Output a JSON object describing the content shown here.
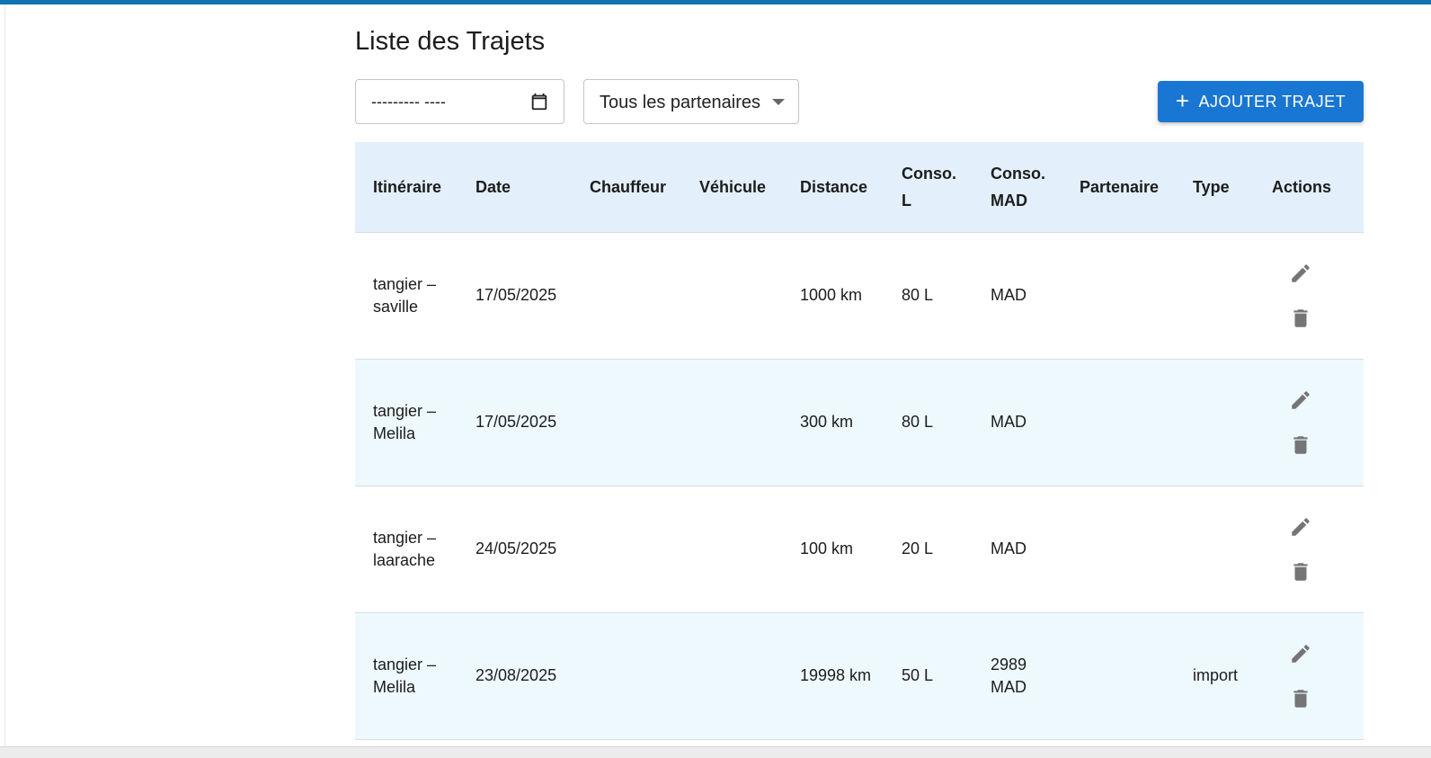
{
  "page": {
    "title": "Liste des Trajets"
  },
  "filters": {
    "date_value": "--------- ----",
    "date_icon": "calendar-icon",
    "partner_select_value": "Tous les partenaires",
    "add_button_label": "AJOUTER TRAJET",
    "add_button_icon": "plus-icon"
  },
  "table": {
    "headers": [
      "Itinéraire",
      "Date",
      "Chauffeur",
      "Véhicule",
      "Distance",
      "Conso. L",
      "Conso. MAD",
      "Partenaire",
      "Type",
      "Actions"
    ],
    "rows": [
      {
        "itineraire": "tangier – saville",
        "date": "17/05/2025",
        "chauffeur": "",
        "vehicule": "",
        "distance": "1000 km",
        "conso_l": "80 L",
        "conso_mad": "MAD",
        "partenaire": "",
        "type": ""
      },
      {
        "itineraire": "tangier – Melila",
        "date": "17/05/2025",
        "chauffeur": "",
        "vehicule": "",
        "distance": "300 km",
        "conso_l": "80 L",
        "conso_mad": "MAD",
        "partenaire": "",
        "type": ""
      },
      {
        "itineraire": "tangier – laarache",
        "date": "24/05/2025",
        "chauffeur": "",
        "vehicule": "",
        "distance": "100 km",
        "conso_l": "20 L",
        "conso_mad": "MAD",
        "partenaire": "",
        "type": ""
      },
      {
        "itineraire": "tangier – Melila",
        "date": "23/08/2025",
        "chauffeur": "",
        "vehicule": "",
        "distance": "19998 km",
        "conso_l": "50 L",
        "conso_mad": "2989 MAD",
        "partenaire": "",
        "type": "import"
      }
    ],
    "row_icons": [
      "edit-icon",
      "delete-icon"
    ]
  },
  "colors": {
    "accent": "#1976d2",
    "top_bar": "#1273b0",
    "header_bg": "#e3f0fb",
    "alt_row_bg": "#eef9fe",
    "icon": "#757575"
  }
}
